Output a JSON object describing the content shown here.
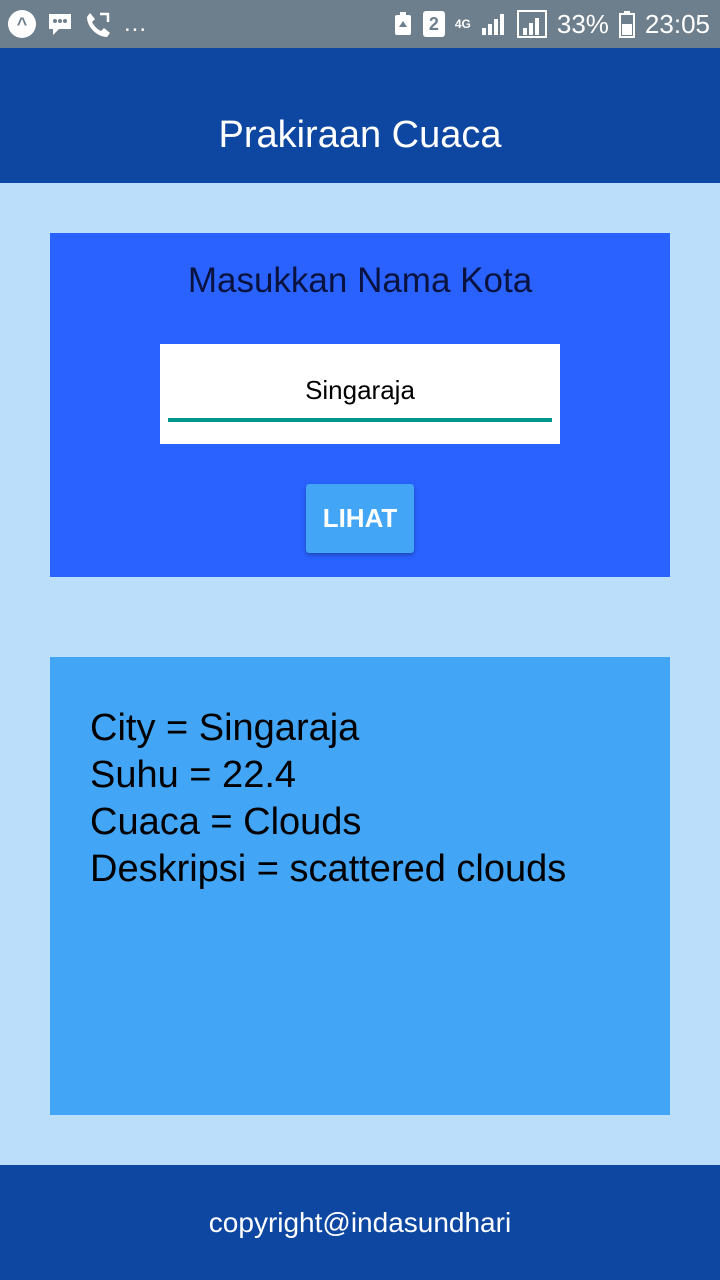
{
  "status_bar": {
    "left_icons": [
      "app-launcher-icon",
      "bbm-icon",
      "call-forward-icon"
    ],
    "more": "...",
    "badge": "2",
    "network": "4G",
    "battery_percent": "33%",
    "time": "23:05"
  },
  "app_bar": {
    "title": "Prakiraan Cuaca"
  },
  "search": {
    "label": "Masukkan Nama Kota",
    "input_value": "Singaraja",
    "button_label": "LIHAT"
  },
  "result": {
    "city": "City = Singaraja",
    "temp": "Suhu = 22.4",
    "weather": "Cuaca = Clouds",
    "description": "Deskripsi = scattered clouds"
  },
  "footer": {
    "text": "copyright@indasundhari"
  },
  "colors": {
    "status_bar": "#6d7f8d",
    "primary_dark": "#0d47a1",
    "background": "#bbdefb",
    "search_card": "#2962ff",
    "result_card": "#42a5f5",
    "input_underline": "#009688"
  }
}
